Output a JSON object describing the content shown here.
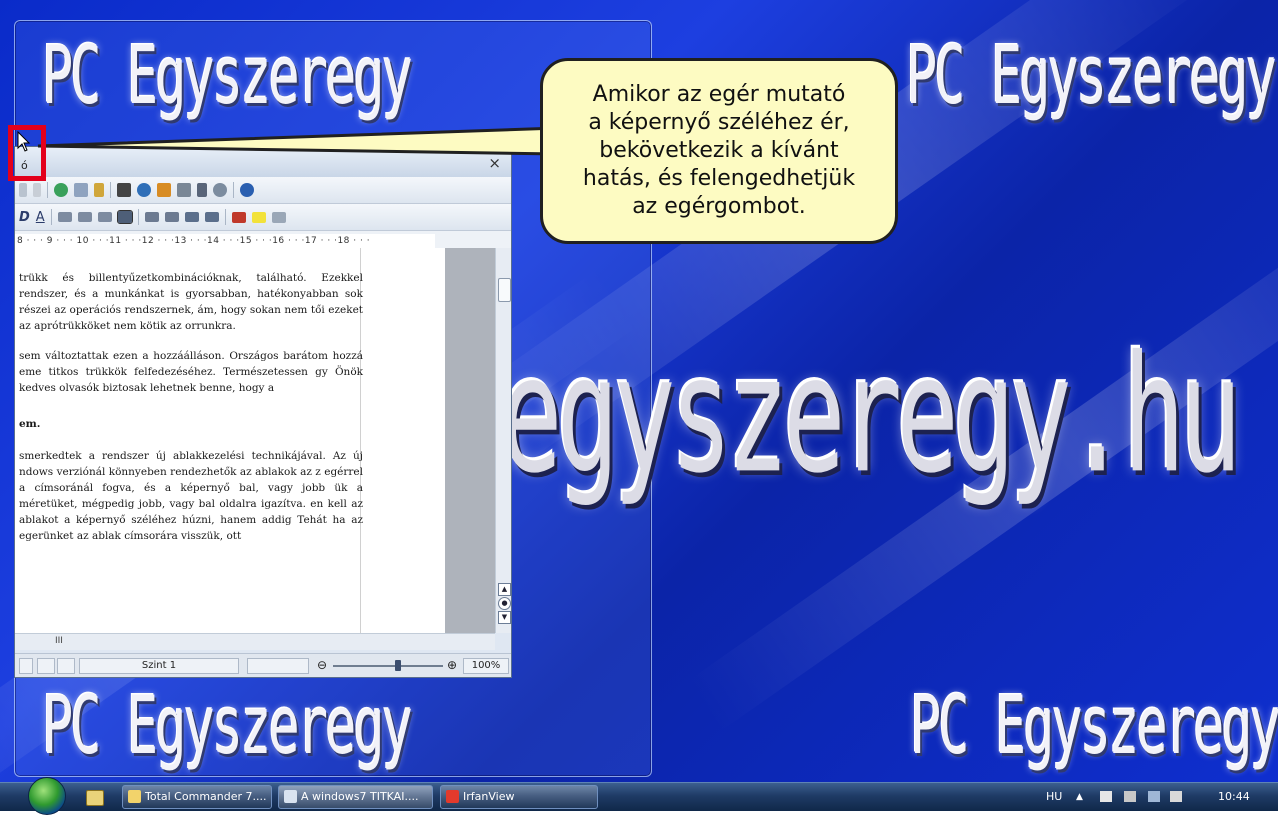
{
  "wallpaper": {
    "brand_text": "PC Egyszeregy",
    "site_text": "egyszeregy.hu"
  },
  "callout": {
    "text": "Amikor az egér mutató\na képernyő széléhez ér,\nbekövetkezik a kívánt\nhatás, és felengedhetjük\naz egérgombot."
  },
  "writer": {
    "title_fragment": "ó",
    "close_glyph": "×",
    "ruler_text": "8 · · · 9 · · · 10 · · ·11 · · ·12 · · ·13 · · ·14 · · ·15 · · ·16 · · ·17 · · ·18 · · ·",
    "paragraphs": [
      "trükk és billentyűzetkombinációknak, található. Ezekkel rendszer, és a munkánkat is gyorsabban, hatékonyabban sok részei az operációs rendszernek, ám, hogy sokan nem tői ezeket az aprótrükköket nem kötik az orrunkra.",
      "sem változtattak ezen a hozzáálláson. Országos barátom hozzá eme titkos trükkök felfedezéséhez. Természetessen gy Önök kedves olvasók biztosak lehetnek benne, hogy a"
    ],
    "heading_fragment": "em.",
    "paragraph3": "smerkedtek a rendszer új ablakkezelési technikájával. Az új ndows verziónál könnyeben rendezhetők az ablakok az z egérrel a címsoránál fogva, és a képernyő bal, vagy jobb ük a méretüket, mégpedig jobb, vagy bal oldalra igazítva. en kell az ablakot a képernyő széléhez húzni, hanem addig Tehát ha az egerünket az ablak címsorára visszük, ott",
    "hscroll_label": "III",
    "status_level": "Szint 1",
    "zoom_value": "100%",
    "zoom_minus": "⊖",
    "zoom_plus": "⊕"
  },
  "taskbar": {
    "tasks": [
      {
        "label": "Total Commander 7...."
      },
      {
        "label": "A windows7 TITKAI...."
      },
      {
        "label": "IrfanView"
      }
    ],
    "language": "HU",
    "clock": "10:44"
  },
  "colors": {
    "highlight": "#e3001b",
    "callout_fill": "#fdfbc2",
    "desktop_blue": "#1d3fe0"
  }
}
